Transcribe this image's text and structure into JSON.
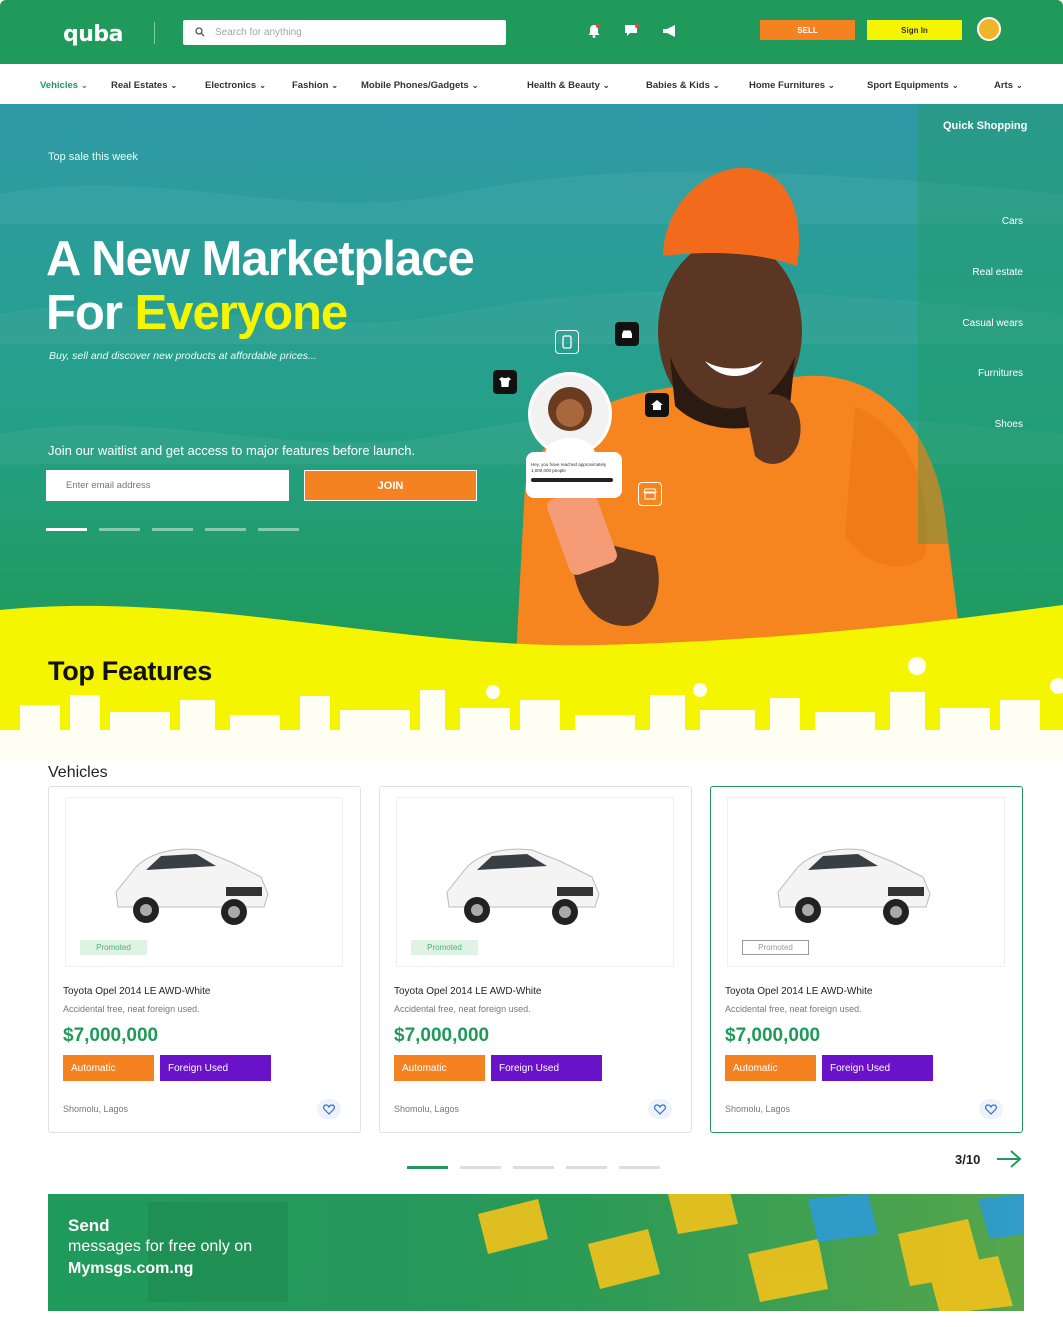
{
  "header": {
    "logo": "quba",
    "search_placeholder": "Search for anything",
    "sell_label": "SELL",
    "signin_label": "Sign In"
  },
  "nav": {
    "items": [
      {
        "label": "Vehicles"
      },
      {
        "label": "Real Estates"
      },
      {
        "label": "Electronics"
      },
      {
        "label": "Fashion"
      },
      {
        "label": "Mobile Phones/Gadgets"
      },
      {
        "label": "Health & Beauty"
      },
      {
        "label": "Babies & Kids"
      },
      {
        "label": "Home Furnitures"
      },
      {
        "label": "Sport Equipments"
      },
      {
        "label": "Arts"
      }
    ]
  },
  "hero": {
    "kicker": "Top sale this week",
    "title_line1": "A New Marketplace",
    "title_for": "For",
    "title_highlight": "Everyone",
    "subtitle": "Buy, sell and discover new products at affordable prices...",
    "waitlist_text": "Join our waitlist and get access to major features before launch.",
    "email_placeholder": "Enter email address",
    "join_label": "JOIN",
    "slides_total": 5,
    "slide_active": 1,
    "notification_text": "Hey, you have reached approximately 1,000,000 people"
  },
  "quick_shopping": {
    "title": "Quick Shopping",
    "items": [
      "Cars",
      "Real estate",
      "Casual wears",
      "Furnitures",
      "Shoes"
    ]
  },
  "features": {
    "title": "Top Features",
    "section": "Vehicles",
    "cards": [
      {
        "badge": "Promoted",
        "title": "Toyota Opel 2014 LE AWD-White",
        "desc": "Accidental free, neat foreign used.",
        "price": "$7,000,000",
        "tag1": "Automatic",
        "tag2": "Foreign Used",
        "location": "Shomolu, Lagos"
      },
      {
        "badge": "Promoted",
        "title": "Toyota Opel 2014 LE AWD-White",
        "desc": "Accidental free, neat foreign used.",
        "price": "$7,000,000",
        "tag1": "Automatic",
        "tag2": "Foreign Used",
        "location": "Shomolu, Lagos"
      },
      {
        "badge": "Promoted",
        "title": "Toyota Opel 2014 LE AWD-White",
        "desc": "Accidental free, neat foreign used.",
        "price": "$7,000,000",
        "tag1": "Automatic",
        "tag2": "Foreign Used",
        "location": "Shomolu, Lagos"
      }
    ],
    "pager_count": "3/10",
    "pager_total": 5,
    "pager_active": 1
  },
  "banner": {
    "line1": "Send",
    "line2": "messages for free only on",
    "line3": "Mymsgs.com.ng"
  },
  "colors": {
    "green": "#1f9a5a",
    "orange": "#f58220",
    "yellow": "#f5f500",
    "purple": "#6a12c9"
  }
}
